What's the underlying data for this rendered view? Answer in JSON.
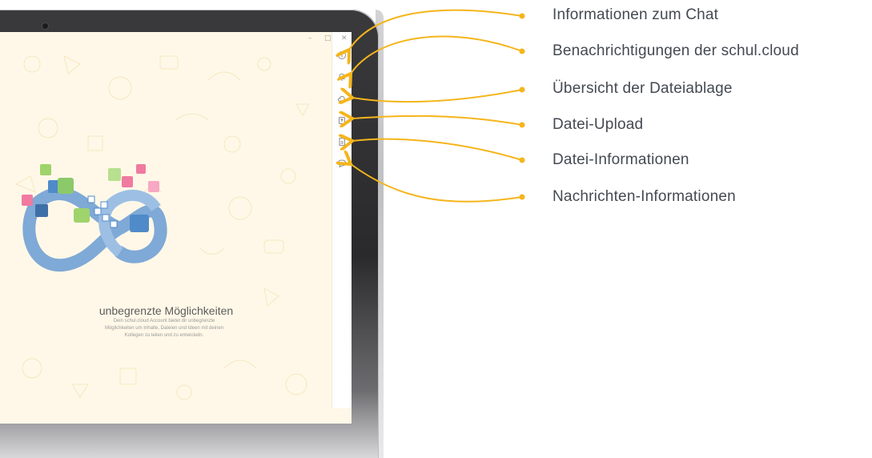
{
  "accent_color": "#f5b51b",
  "window_controls": [
    "–",
    "□",
    "✕"
  ],
  "sidebar_icons": [
    {
      "icon": "info-icon"
    },
    {
      "icon": "bell-icon"
    },
    {
      "icon": "cloud-icon"
    },
    {
      "icon": "upload-icon"
    },
    {
      "icon": "file-icon"
    },
    {
      "icon": "chat-bubble-icon"
    }
  ],
  "main": {
    "headline": "unbegrenzte Möglichkeiten",
    "subtext_line1": "Dein schul.cloud Account bietet dir unbegrenzte",
    "subtext_line2": "Möglichkeiten um Inhalte, Dateien und Ideen mit deinen",
    "subtext_line3": "Kollegen zu teilen und zu entwickeln."
  },
  "callouts": [
    {
      "label": "Informationen zum Chat"
    },
    {
      "label": "Benachrichtigungen der schul.cloud"
    },
    {
      "label": "Übersicht der Dateiablage"
    },
    {
      "label": "Datei-Upload"
    },
    {
      "label": "Datei-Informationen"
    },
    {
      "label": "Nachrichten-Informationen"
    }
  ]
}
